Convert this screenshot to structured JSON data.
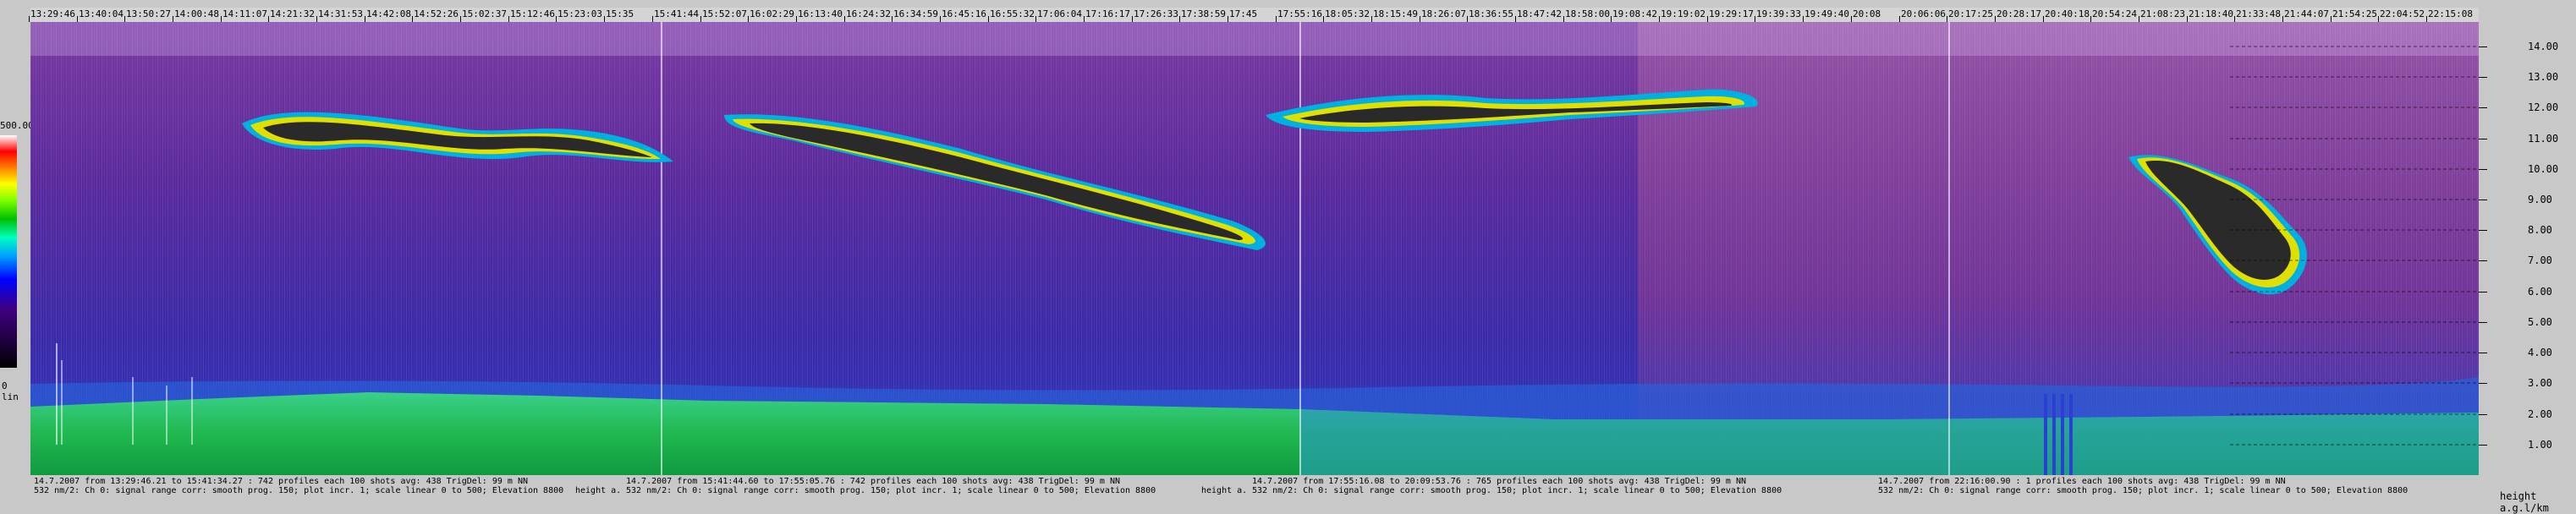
{
  "chart_data": {
    "type": "heatmap",
    "time_ticks": [
      "13:29:46",
      "13:40:04",
      "13:50:27",
      "14:00:48",
      "14:11:07",
      "14:21:32",
      "14:31:53",
      "14:42:08",
      "14:52:26",
      "15:02:37",
      "15:12:46",
      "15:23:03",
      "15:35",
      "15:41:44",
      "15:52:07",
      "16:02:29",
      "16:13:40",
      "16:24:32",
      "16:34:59",
      "16:45:16",
      "16:55:32",
      "17:06:04",
      "17:16:17",
      "17:26:33",
      "17:38:59",
      "17:45",
      "17:55:16",
      "18:05:32",
      "18:15:49",
      "18:26:07",
      "18:36:55",
      "18:47:42",
      "18:58:00",
      "19:08:42",
      "19:19:02",
      "19:29:17",
      "19:39:33",
      "19:49:40",
      "20:08",
      "20:06:06",
      "20:17:25",
      "20:28:17",
      "20:40:18",
      "20:54:24",
      "21:08:23",
      "21:18:40",
      "21:33:48",
      "21:44:07",
      "21:54:25",
      "22:04:52",
      "22:15:08"
    ],
    "height_ticks": [
      "1.00",
      "2.00",
      "3.00",
      "4.00",
      "5.00",
      "6.00",
      "7.00",
      "8.00",
      "9.00",
      "10.00",
      "11.00",
      "12.00",
      "13.00",
      "14.00"
    ],
    "ylim": [
      0,
      14.8
    ],
    "colorbar_max": "500.00",
    "colorbar_min": "0",
    "colorbar_unit": "lin",
    "ylabel": "height a.g.l/km",
    "ylabel_left": "height a.",
    "ylabel_right": "height a.",
    "segments": [
      {
        "line1": "14.7.2007 from 13:29:46.21 to 15:41:34.27 : 742 profiles  each 100 shots avg: 438 TrigDel: 99 m NN",
        "line2": "532 nm/2: Ch 0:  signal range corr: smooth prog. 150; plot incr. 1; scale linear 0 to 500; Elevation 8800"
      },
      {
        "line1": "14.7.2007 from 15:41:44.60 to 17:55:05.76 : 742 profiles  each 100 shots avg: 438 TrigDel: 99 m NN",
        "line2": "532 nm/2: Ch 0:  signal range corr: smooth prog. 150; plot incr. 1; scale linear 0 to 500; Elevation 8800"
      },
      {
        "line1": "14.7.2007 from 17:55:16.08 to 20:09:53.76 : 765 profiles  each 100 shots avg: 438 TrigDel: 99 m NN",
        "line2": "532 nm/2: Ch 0:  signal range corr: smooth prog. 150; plot incr. 1; scale linear 0 to 500; Elevation 8800"
      },
      {
        "line1": "14.7.2007 from 22:16:00.90 : 1 profiles  each 100 shots avg: 438 TrigDel: 99 m NN",
        "line2": "532 nm/2: Ch 0:  signal range corr: smooth prog. 150; plot incr. 1; scale linear 0 to 500; Elevation 8800"
      }
    ],
    "colors": {
      "background": "#5a2aa8",
      "boundary_layer": "#22b45a",
      "aerosol_top": "#2a6ae0",
      "cloud_core": "#2a2a2a",
      "cloud_edge": "#e0e000"
    }
  }
}
